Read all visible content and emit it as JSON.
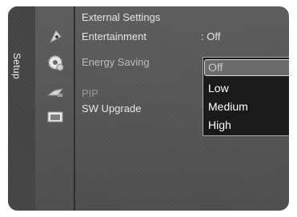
{
  "side_tab": {
    "label": "Setup"
  },
  "categories": [
    {
      "icon": "satellite-dish-icon"
    },
    {
      "icon": "gear-icon"
    },
    {
      "icon": "input-plug-icon"
    },
    {
      "icon": "picture-icon"
    }
  ],
  "menu": {
    "items": [
      {
        "label": "External Settings"
      },
      {
        "label": "Entertainment",
        "value": ": Off"
      },
      {
        "label": "Energy Saving"
      },
      {
        "label": "PIP"
      },
      {
        "label": "SW Upgrade"
      }
    ]
  },
  "dropdown": {
    "options": [
      "Off",
      "Low",
      "Medium",
      "High"
    ],
    "selected": "Off"
  }
}
